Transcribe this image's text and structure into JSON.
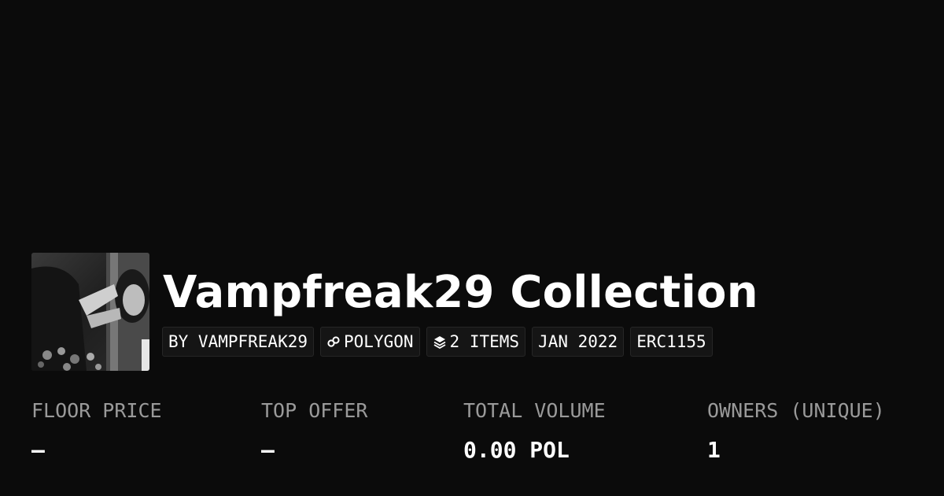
{
  "collection": {
    "title": "Vampfreak29 Collection",
    "thumbnail_icon": "collection-avatar-photo",
    "tags": [
      {
        "label": "BY VAMPFREAK29",
        "icon": null
      },
      {
        "label": "POLYGON",
        "icon": "chain-link-icon"
      },
      {
        "label": "2 ITEMS",
        "icon": "layers-icon"
      },
      {
        "label": "JAN 2022",
        "icon": null
      },
      {
        "label": "ERC1155",
        "icon": null
      }
    ]
  },
  "stats": [
    {
      "label": "FLOOR PRICE",
      "value": "–"
    },
    {
      "label": "TOP OFFER",
      "value": "–"
    },
    {
      "label": "TOTAL VOLUME",
      "value": "0.00 POL"
    },
    {
      "label": "OWNERS (UNIQUE)",
      "value": "1"
    }
  ],
  "colors": {
    "background": "#0b0b0b",
    "text": "#ffffff",
    "muted": "#9a9a9a",
    "tag_bg": "#151515",
    "tag_border": "#262626"
  }
}
